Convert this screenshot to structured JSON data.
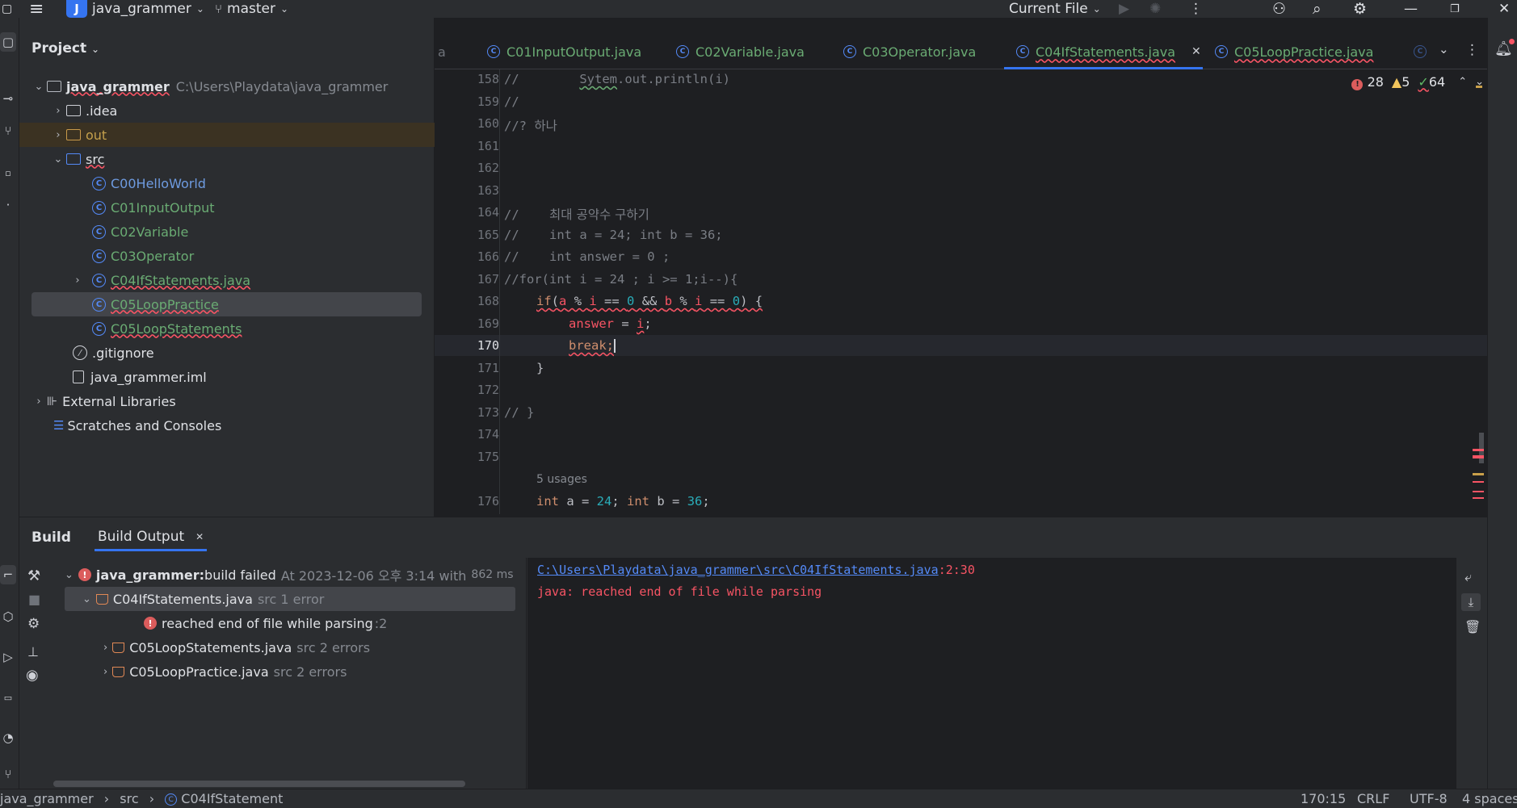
{
  "topbar": {
    "project_badge": "J",
    "project_name": "java_grammer",
    "branch": "master",
    "run_config": "Current File"
  },
  "project_panel": {
    "title": "Project",
    "root_name": "java_grammer",
    "root_path": "C:\\Users\\Playdata\\java_grammer",
    "items": [
      {
        "label": ".idea"
      },
      {
        "label": "out"
      },
      {
        "label": "src"
      },
      {
        "label": "C00HelloWorld"
      },
      {
        "label": "C01InputOutput"
      },
      {
        "label": "C02Variable"
      },
      {
        "label": "C03Operator"
      },
      {
        "label": "C04IfStatements.java"
      },
      {
        "label": "C05LoopPractice"
      },
      {
        "label": "C05LoopStatements"
      },
      {
        "label": ".gitignore"
      },
      {
        "label": "java_grammer.iml"
      },
      {
        "label": "External Libraries"
      },
      {
        "label": "Scratches and Consoles"
      }
    ]
  },
  "editor_tabs": [
    {
      "label": "a"
    },
    {
      "label": "C01InputOutput.java"
    },
    {
      "label": "C02Variable.java"
    },
    {
      "label": "C03Operator.java"
    },
    {
      "label": "C04IfStatements.java"
    },
    {
      "label": "C05LoopPractice.java"
    }
  ],
  "inspections": {
    "errors": "28",
    "warnings": "5",
    "typos": "64"
  },
  "code_lines": [
    {
      "n": "158"
    },
    {
      "n": "159"
    },
    {
      "n": "160"
    },
    {
      "n": "161"
    },
    {
      "n": "162"
    },
    {
      "n": "163"
    },
    {
      "n": "164"
    },
    {
      "n": "165"
    },
    {
      "n": "166"
    },
    {
      "n": "167"
    },
    {
      "n": "168"
    },
    {
      "n": "169"
    },
    {
      "n": "170"
    },
    {
      "n": "171"
    },
    {
      "n": "172"
    },
    {
      "n": "173"
    },
    {
      "n": "174"
    },
    {
      "n": "175"
    },
    {
      "n": "176"
    }
  ],
  "code": {
    "l158a": "//        ",
    "l158b": "Sytem",
    "l158c": ".out.println(i)",
    "l159": "//",
    "l160a": "//? ",
    "l160b": "하나",
    "l164a": "//    ",
    "l164b": "최대 공약수 구하기",
    "l165": "//    int a = 24; int b = 36;",
    "l166": "//    int answer = 0 ;",
    "l167": "//for(int i = 24 ; i >= 1;i--){",
    "l168_if": "if",
    "l168_open": "(",
    "l168_a": "a",
    "l168_mod1": " % ",
    "l168_i1": "i",
    "l168_eq1": " == ",
    "l168_zero1": "0",
    "l168_and": " && ",
    "l168_b": "b",
    "l168_mod2": " % ",
    "l168_i2": "i",
    "l168_eq2": " == ",
    "l168_zero2": "0",
    "l168_close": ") {",
    "l169_answer": "answer",
    "l169_eq": " = ",
    "l169_i": "i",
    "l169_semi": ";",
    "l170": "break;",
    "l171": "}",
    "l173": "// }",
    "usages": "5 usages",
    "l176_int1": "int",
    "l176_a": " a = ",
    "l176_24": "24",
    "l176_semi1": "; ",
    "l176_int2": "int",
    "l176_b": " b = ",
    "l176_36": "36",
    "l176_semi2": ";"
  },
  "build": {
    "tab_build": "Build",
    "tab_output": "Build Output",
    "root_project": "java_grammer:",
    "root_status": " build failed",
    "root_time": "At 2023-12-06 오후 3:14 with",
    "root_ms": "862 ms",
    "file1": "C04IfStatements.java",
    "file1_meta": "src 1 error",
    "msg1": "reached end of file while parsing",
    "msg1_line": ":2",
    "file2": "C05LoopStatements.java",
    "file2_meta": "src 2 errors",
    "file3": "C05LoopPractice.java",
    "file3_meta": "src 2 errors",
    "out_path": "C:\\Users\\Playdata\\java_grammer\\src\\C04IfStatements.java",
    "out_pos": ":2:30",
    "out_msg": "java: reached end of file while parsing"
  },
  "status": {
    "crumb1": "java_grammer",
    "crumb2": "src",
    "crumb3": "C04IfStatement",
    "pos": "170:15",
    "eol": "CRLF",
    "enc": "UTF-8",
    "indent": "4 spaces"
  },
  "colors": {
    "accent": "#3574f0",
    "error": "#f75464",
    "green": "#6aab73"
  }
}
